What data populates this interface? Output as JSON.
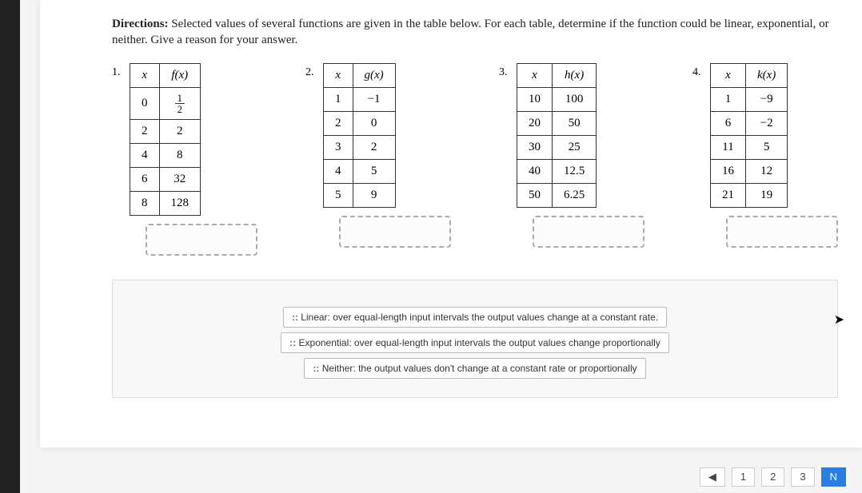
{
  "directions_label": "Directions:",
  "directions_text": " Selected values of several functions are given in the table below. For each table, determine if the function could be linear, exponential, or neither. Give a reason for your answer.",
  "tables": [
    {
      "num": "1.",
      "xh": "x",
      "fh": "f(x)",
      "rows": [
        [
          "0",
          "__FRAC_1_2__"
        ],
        [
          "2",
          "2"
        ],
        [
          "4",
          "8"
        ],
        [
          "6",
          "32"
        ],
        [
          "8",
          "128"
        ]
      ]
    },
    {
      "num": "2.",
      "xh": "x",
      "fh": "g(x)",
      "rows": [
        [
          "1",
          "−1"
        ],
        [
          "2",
          "0"
        ],
        [
          "3",
          "2"
        ],
        [
          "4",
          "5"
        ],
        [
          "5",
          "9"
        ]
      ]
    },
    {
      "num": "3.",
      "xh": "x",
      "fh": "h(x)",
      "rows": [
        [
          "10",
          "100"
        ],
        [
          "20",
          "50"
        ],
        [
          "30",
          "25"
        ],
        [
          "40",
          "12.5"
        ],
        [
          "50",
          "6.25"
        ]
      ]
    },
    {
      "num": "4.",
      "xh": "x",
      "fh": "k(x)",
      "rows": [
        [
          "1",
          "−9"
        ],
        [
          "6",
          "−2"
        ],
        [
          "11",
          "5"
        ],
        [
          "16",
          "12"
        ],
        [
          "21",
          "19"
        ]
      ]
    }
  ],
  "answers": {
    "linear": "Linear: over equal-length input intervals the output values change at a constant rate.",
    "exponential": "Exponential: over equal-length input intervals the output values change proportionally",
    "neither": "Neither: the output values don't change at a constant rate or proportionally"
  },
  "pager": {
    "prev": "◀",
    "p1": "1",
    "p2": "2",
    "p3": "3",
    "next": "N"
  },
  "chart_data": [
    {
      "type": "table",
      "title": "f(x)",
      "x": [
        0,
        2,
        4,
        6,
        8
      ],
      "y": [
        0.5,
        2,
        8,
        32,
        128
      ]
    },
    {
      "type": "table",
      "title": "g(x)",
      "x": [
        1,
        2,
        3,
        4,
        5
      ],
      "y": [
        -1,
        0,
        2,
        5,
        9
      ]
    },
    {
      "type": "table",
      "title": "h(x)",
      "x": [
        10,
        20,
        30,
        40,
        50
      ],
      "y": [
        100,
        50,
        25,
        12.5,
        6.25
      ]
    },
    {
      "type": "table",
      "title": "k(x)",
      "x": [
        1,
        6,
        11,
        16,
        21
      ],
      "y": [
        -9,
        -2,
        5,
        12,
        19
      ]
    }
  ]
}
